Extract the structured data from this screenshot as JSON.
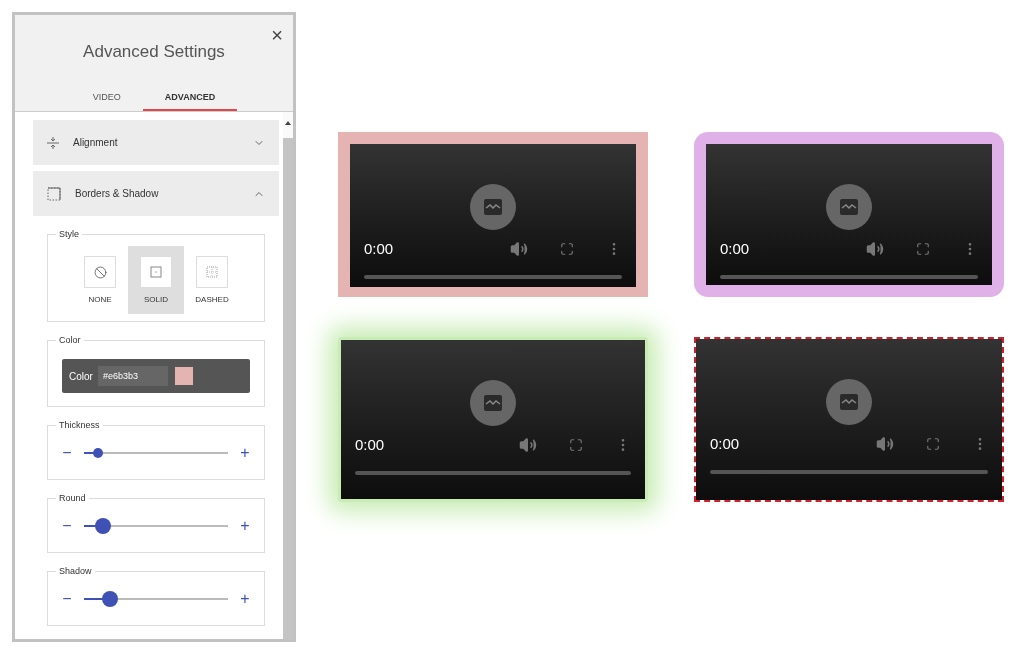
{
  "panel": {
    "title": "Advanced Settings",
    "close": "×",
    "tabs": [
      {
        "label": "VIDEO",
        "selected": false
      },
      {
        "label": "ADVANCED",
        "selected": true
      }
    ],
    "sections": [
      {
        "kind": "alignment",
        "label": "Alignment",
        "expanded": false
      },
      {
        "kind": "borders",
        "label": "Borders & Shadow",
        "expanded": true
      }
    ],
    "style": {
      "legend": "Style",
      "options": [
        {
          "kind": "none",
          "label": "NONE",
          "selected": false
        },
        {
          "kind": "solid",
          "label": "SOLID",
          "selected": true
        },
        {
          "kind": "dashed",
          "label": "DASHED",
          "selected": false
        }
      ]
    },
    "color": {
      "legend": "Color",
      "label": "Color",
      "value": "#e6b3b3",
      "color": "#e6b3b3"
    },
    "sliders": [
      {
        "legend": "Thickness",
        "minus": "−",
        "plus": "+",
        "level": 0.1,
        "kind": "small"
      },
      {
        "legend": "Round",
        "minus": "−",
        "plus": "+",
        "level": 0.13,
        "kind": "large"
      },
      {
        "legend": "Shadow",
        "minus": "−",
        "plus": "+",
        "level": 0.18,
        "kind": "large"
      }
    ]
  },
  "videos": [
    {
      "kind": "solid",
      "color": "#e6b3b3",
      "time": "0:00"
    },
    {
      "kind": "rounded",
      "color": "#e0b0e8",
      "time": "0:00"
    },
    {
      "kind": "shadow",
      "color": "#c8ecb4",
      "time": "0:00"
    },
    {
      "kind": "dashed",
      "color": "#d0202a",
      "time": "0:00"
    }
  ]
}
